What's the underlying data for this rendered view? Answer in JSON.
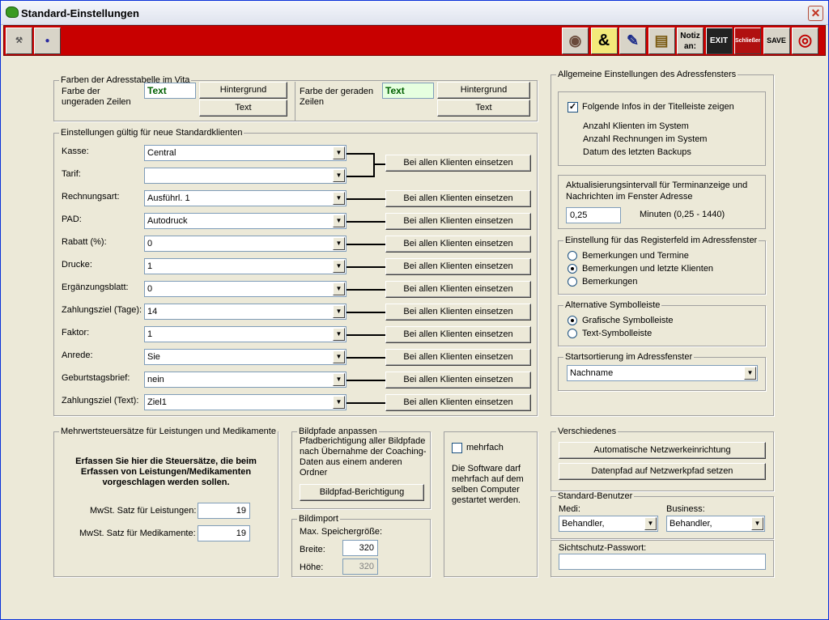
{
  "window": {
    "title": "Standard-Einstellungen"
  },
  "toolbar": {
    "left_icons": [
      "tools-icon",
      "billiard-icon"
    ],
    "right_icons": [
      {
        "name": "eye-icon",
        "glyph": "◉"
      },
      {
        "name": "ampersand-icon",
        "glyph": "&"
      },
      {
        "name": "strike-pen-icon",
        "glyph": "✎"
      },
      {
        "name": "book-icon",
        "glyph": "▤"
      },
      {
        "name": "notiz-an-icon",
        "glyph": "Notiz an:"
      },
      {
        "name": "exit-icon",
        "glyph": "EXIT"
      },
      {
        "name": "schliessen-icon",
        "glyph": "Schließen"
      },
      {
        "name": "save-icon",
        "glyph": "SAVE"
      },
      {
        "name": "target-icon",
        "glyph": "◎"
      }
    ]
  },
  "farben": {
    "legend": "Farben der Adresstabelle im Vita",
    "odd_label": "Farbe der ungeraden Zeilen",
    "odd_sample": "Text",
    "even_label": "Farbe der geraden Zeilen",
    "even_sample": "Text",
    "hintergrund": "Hintergrund",
    "text": "Text"
  },
  "einstellungen": {
    "legend": "Einstellungen gültig für neue Standardklienten",
    "button_label": "Bei allen Klienten einsetzen",
    "rows": [
      {
        "label": "Kasse:",
        "value": "Central"
      },
      {
        "label": "Tarif:",
        "value": ""
      },
      {
        "label": "Rechnungsart:",
        "value": "Ausführl. 1"
      },
      {
        "label": "PAD:",
        "value": "Autodruck"
      },
      {
        "label": "Rabatt (%):",
        "value": "0"
      },
      {
        "label": "Drucke:",
        "value": "1"
      },
      {
        "label": "Ergänzungsblatt:",
        "value": "0"
      },
      {
        "label": "Zahlungsziel (Tage):",
        "value": "14"
      },
      {
        "label": "Faktor:",
        "value": "1"
      },
      {
        "label": "Anrede:",
        "value": "Sie"
      },
      {
        "label": "Geburtstagsbrief:",
        "value": "nein"
      },
      {
        "label": "Zahlungsziel (Text):",
        "value": "Ziel1"
      }
    ]
  },
  "mwst": {
    "legend": "Mehrwertsteuersätze für Leistungen und Medikamente",
    "description": "Erfassen Sie hier die Steuersätze, die beim Erfassen von Leistungen/Medikamenten vorgeschlagen werden sollen.",
    "leistungen_label": "MwSt. Satz für Leistungen:",
    "leistungen_value": "19",
    "medikamente_label": "MwSt. Satz für Medikamente:",
    "medikamente_value": "19"
  },
  "bildpfade": {
    "legend": "Bildpfade anpassen",
    "description": "Pfadberichtigung aller Bildpfade nach Übernahme der Coaching-Daten aus einem anderen Ordner",
    "button": "Bildpfad-Berichtigung"
  },
  "bildimport": {
    "legend": "Bildimport",
    "max_label": "Max. Speichergröße:",
    "breite_label": "Breite:",
    "breite_value": "320",
    "hoehe_label": "Höhe:",
    "hoehe_value": "320"
  },
  "mehrfach": {
    "label": "mehrfach",
    "checked": false,
    "description": "Die Software darf mehrfach auf dem selben Computer gestartet werden."
  },
  "allgemein": {
    "legend": "Allgemeine Einstellungen des Adressfensters",
    "titel_checkbox": "Folgende Infos in der Titelleiste zeigen",
    "titel_checked": true,
    "infos": [
      "Anzahl Klienten im System",
      "Anzahl Rechnungen im System",
      "Datum des letzten Backups"
    ],
    "intervall_label": "Aktualisierungsintervall für Terminanzeige und Nachrichten im Fenster Adresse",
    "intervall_value": "0,25",
    "intervall_unit": "Minuten (0,25 - 1440)",
    "register_legend": "Einstellung für das Registerfeld im Adressfenster",
    "register_options": [
      "Bemerkungen und Termine",
      "Bemerkungen und letzte Klienten",
      "Bemerkungen"
    ],
    "register_selected": 1,
    "symbol_legend": "Alternative Symbolleiste",
    "symbol_options": [
      "Grafische Symbolleiste",
      "Text-Symbolleiste"
    ],
    "symbol_selected": 0,
    "sort_legend": "Startsortierung im Adressfenster",
    "sort_value": "Nachname"
  },
  "verschiedenes": {
    "legend": "Verschiedenes",
    "netzwerk_button": "Automatische Netzwerkeinrichtung",
    "datenpfad_button": "Datenpfad auf Netzwerkpfad setzen"
  },
  "benutzer": {
    "legend": "Standard-Benutzer",
    "medi_label": "Medi:",
    "medi_value": "Behandler,",
    "business_label": "Business:",
    "business_value": "Behandler,"
  },
  "sichtschutz": {
    "label": "Sichtschutz-Passwort:",
    "value": ""
  }
}
